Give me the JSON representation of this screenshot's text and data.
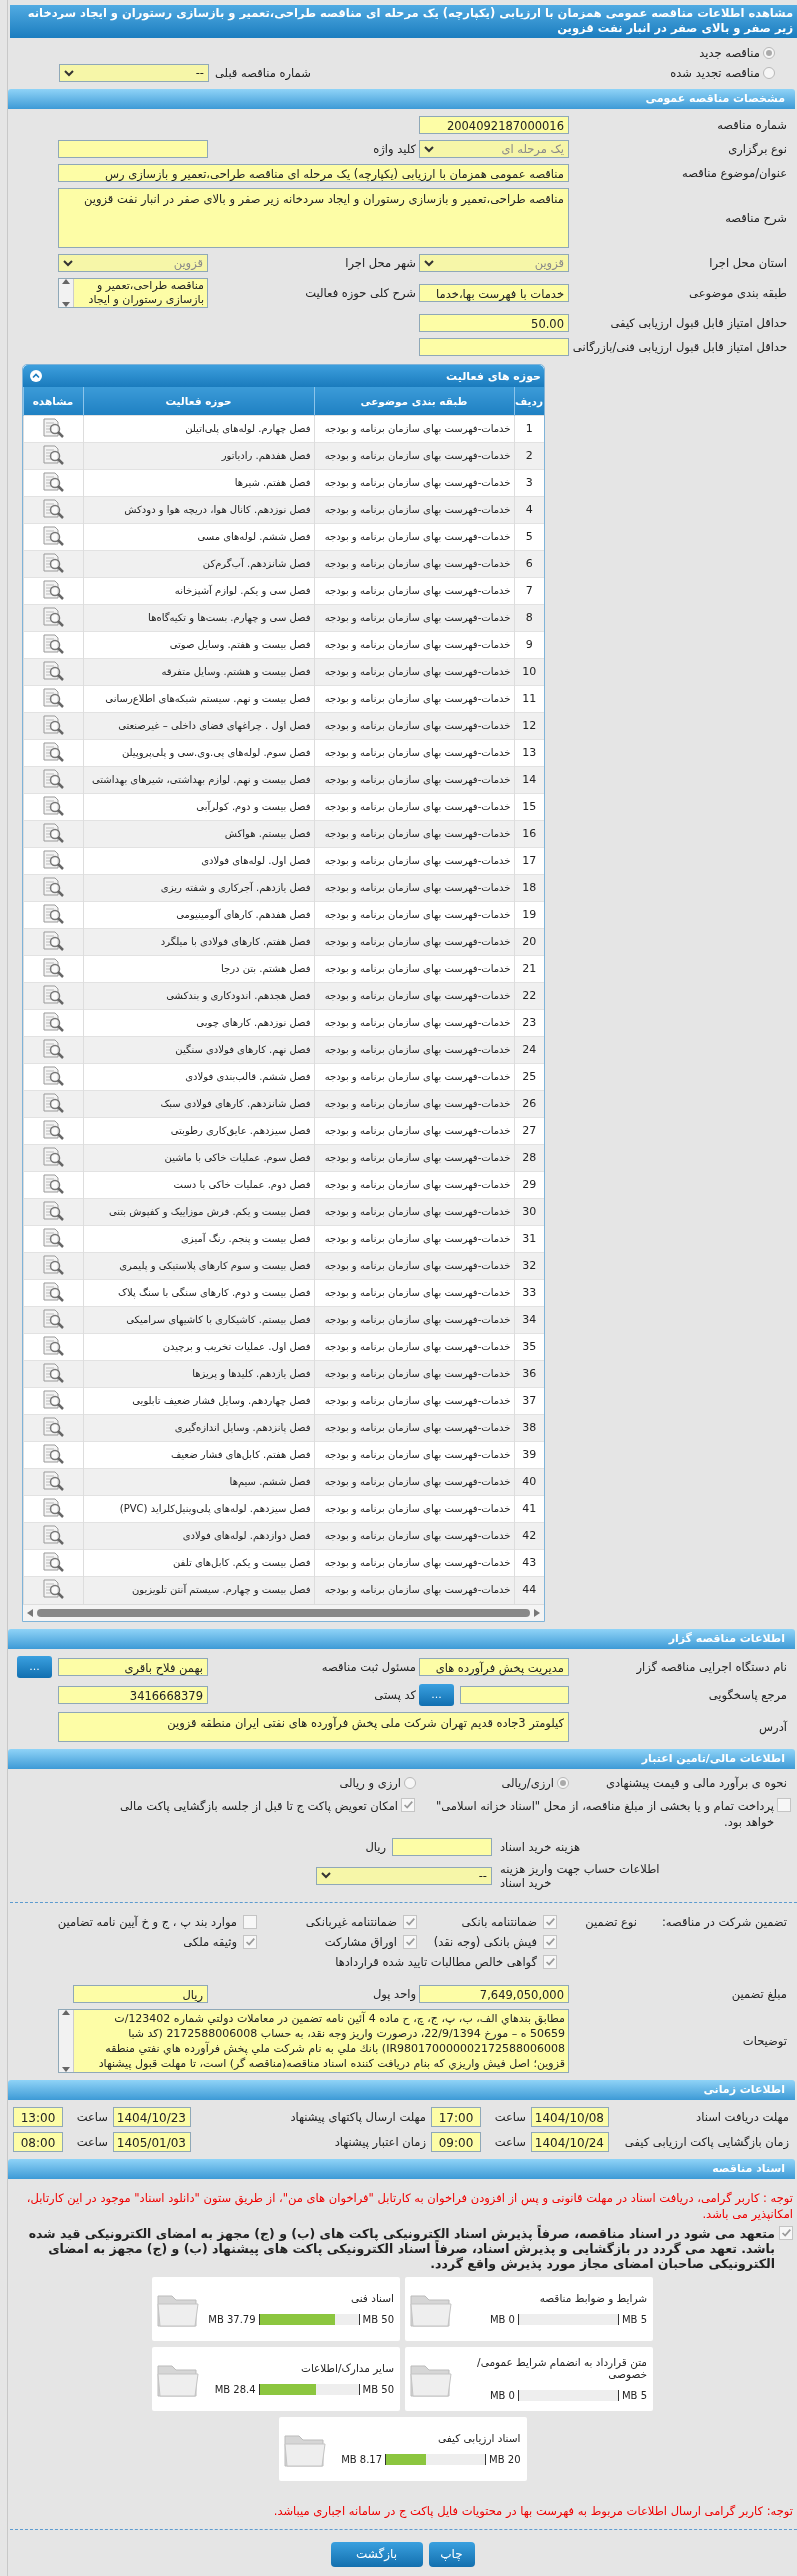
{
  "title": "مشاهده اطلاعات مناقصه عمومی همزمان با ارزیابی (یکپارچه) یک مرحله ای مناقصه طراحی،تعمیر و بازسازی رستوران و ایجاد سردخانه زیر صفر و بالای صفر در انبار نفت قزوین",
  "tender_type": {
    "options": [
      {
        "label": "مناقصه جدید",
        "selected": true
      },
      {
        "label": "مناقصه تجدید شده",
        "selected": false
      }
    ],
    "previous": {
      "label": "شماره مناقصه قبلی",
      "kind": "select",
      "value": "--",
      "disabled": false
    }
  },
  "general": {
    "header": "مشخصات مناقصه عمومی",
    "rows": [
      [
        {
          "label": "شماره مناقصه",
          "kind": "input",
          "value": "2004092187000016"
        }
      ],
      [
        {
          "label": "نوع برگزاری",
          "kind": "select",
          "value": "یک مرحله ای",
          "disabled": true
        },
        {
          "label": "کلید واژه",
          "kind": "input"
        }
      ],
      [
        {
          "label": "عنوان/موضوع مناقصه",
          "kind": "wide",
          "value": "مناقصه عمومی همزمان با ارزیابی (یکپارچه) یک مرحله ای مناقصه طراحی،تعمیر و بازسازی رس"
        }
      ],
      [
        {
          "label": "شرح مناقصه",
          "kind": "textarea",
          "value": "مناقصه طراحی،تعمیر و بازسازی رستوران و ایجاد سردخانه زیر صفر و بالای صفر در انبار نفت قزوین"
        }
      ],
      [
        {
          "label": "استان محل اجرا",
          "kind": "select",
          "value": "قزوین",
          "disabled": true
        },
        {
          "label": "شهر محل اجرا",
          "kind": "select",
          "value": "قزوین",
          "disabled": true
        }
      ],
      [
        {
          "label": "طبقه بندی موضوعی",
          "kind": "input",
          "value": "خدمات با فهرست بها،خدما"
        },
        {
          "label": "شرح کلی حوزه فعالیت",
          "kind": "scrollbox",
          "value": "مناقصه طراحی،تعمیر و بازسازی رستوران و ایجاد"
        }
      ],
      [
        {
          "label": "حداقل امتیاز قابل قبول ارزیابی کیفی",
          "kind": "input",
          "value": "50.00"
        }
      ],
      [
        {
          "label": "حداقل امتیاز قابل قبول ارزیابی فنی/بازرگانی",
          "kind": "input"
        }
      ]
    ]
  },
  "activities": {
    "title": "حوزه های فعالیت",
    "columns": [
      "ردیف",
      "طبقه بندی موضوعی",
      "حوزه فعالیت",
      "مشاهده"
    ],
    "rows": [
      {
        "no": "1",
        "category": "خدمات-فهرست بهای سازمان برنامه و بودجه",
        "activity": "فصل چهارم. لوله‌های پلی‌اتیلن"
      },
      {
        "no": "2",
        "category": "خدمات-فهرست بهای سازمان برنامه و بودجه",
        "activity": "فصل هفدهم. رادیاتور"
      },
      {
        "no": "3",
        "category": "خدمات-فهرست بهای سازمان برنامه و بودجه",
        "activity": "فصل هفتم. شیرها"
      },
      {
        "no": "4",
        "category": "خدمات-فهرست بهای سازمان برنامه و بودجه",
        "activity": "فصل نوزدهم. کانال هوا، دریچه هوا و دودکش"
      },
      {
        "no": "5",
        "category": "خدمات-فهرست بهای سازمان برنامه و بودجه",
        "activity": "فصل ششم. لوله‌های مسی"
      },
      {
        "no": "6",
        "category": "خدمات-فهرست بهای سازمان برنامه و بودجه",
        "activity": "فصل شانزدهم. آب‌گرم‌کن"
      },
      {
        "no": "7",
        "category": "خدمات-فهرست بهای سازمان برنامه و بودجه",
        "activity": "فصل سی و یکم. لوازم آشپزخانه"
      },
      {
        "no": "8",
        "category": "خدمات-فهرست بهای سازمان برنامه و بودجه",
        "activity": "فصل سی و چهارم. بست‌ها و تکیه‌گاه‌ها"
      },
      {
        "no": "9",
        "category": "خدمات-فهرست بهای سازمان برنامه و بودجه",
        "activity": "فصل بیست و هفتم. وسایل صوتی"
      },
      {
        "no": "10",
        "category": "خدمات-فهرست بهای سازمان برنامه و بودجه",
        "activity": "فصل بیست و هشتم. وسایل متفرقه"
      },
      {
        "no": "11",
        "category": "خدمات-فهرست بهای سازمان برنامه و بودجه",
        "activity": "فصل بیست و نهم. سیستم شبکه‌های اطلاع‌رسانی"
      },
      {
        "no": "12",
        "category": "خدمات-فهرست بهای سازمان برنامه و بودجه",
        "activity": "فصل اول . چراغهای فضای داخلی – غیرصنعتی"
      },
      {
        "no": "13",
        "category": "خدمات-فهرست بهای سازمان برنامه و بودجه",
        "activity": "فصل سوم. لوله‌های پی.وی.سی و پلی‌پروپیلن"
      },
      {
        "no": "14",
        "category": "خدمات-فهرست بهای سازمان برنامه و بودجه",
        "activity": "فصل بیست و نهم. لوازم بهداشتی، شیرهای بهداشتی"
      },
      {
        "no": "15",
        "category": "خدمات-فهرست بهای سازمان برنامه و بودجه",
        "activity": "فصل بیست و دوم. کولرآبی"
      },
      {
        "no": "16",
        "category": "خدمات-فهرست بهای سازمان برنامه و بودجه",
        "activity": "فصل بیستم. هواکش"
      },
      {
        "no": "17",
        "category": "خدمات-فهرست بهای سازمان برنامه و بودجه",
        "activity": "فصل اول. لوله‌های فولادی"
      },
      {
        "no": "18",
        "category": "خدمات-فهرست بهای سازمان برنامه و بودجه",
        "activity": "فصل یازدهم. آجرکاری و شفته ریزی"
      },
      {
        "no": "19",
        "category": "خدمات-فهرست بهای سازمان برنامه و بودجه",
        "activity": "فصل هفدهم. کارهای آلومینیومی"
      },
      {
        "no": "20",
        "category": "خدمات-فهرست بهای سازمان برنامه و بودجه",
        "activity": "فصل هفتم. کارهای فولادی با میلگرد"
      },
      {
        "no": "21",
        "category": "خدمات-فهرست بهای سازمان برنامه و بودجه",
        "activity": "فصل هشتم. بتن درجا"
      },
      {
        "no": "22",
        "category": "خدمات-فهرست بهای سازمان برنامه و بودجه",
        "activity": "فصل هجدهم. اندودکاری و بندکشی"
      },
      {
        "no": "23",
        "category": "خدمات-فهرست بهای سازمان برنامه و بودجه",
        "activity": "فصل نوزدهم. کارهای چوبی"
      },
      {
        "no": "24",
        "category": "خدمات-فهرست بهای سازمان برنامه و بودجه",
        "activity": "فصل نهم. کارهای فولادی سنگین"
      },
      {
        "no": "25",
        "category": "خدمات-فهرست بهای سازمان برنامه و بودجه",
        "activity": "فصل ششم. قالب‌بندی فولادی"
      },
      {
        "no": "26",
        "category": "خدمات-فهرست بهای سازمان برنامه و بودجه",
        "activity": "فصل شانزدهم. کارهای فولادی سبک"
      },
      {
        "no": "27",
        "category": "خدمات-فهرست بهای سازمان برنامه و بودجه",
        "activity": "فصل سیزدهم. عایق‌کاری رطوبتی"
      },
      {
        "no": "28",
        "category": "خدمات-فهرست بهای سازمان برنامه و بودجه",
        "activity": "فصل سوم. عملیات خاکی با ماشین"
      },
      {
        "no": "29",
        "category": "خدمات-فهرست بهای سازمان برنامه و بودجه",
        "activity": "فصل دوم. عملیات خاکی با دست"
      },
      {
        "no": "30",
        "category": "خدمات-فهرست بهای سازمان برنامه و بودجه",
        "activity": "فصل بیست و یکم. فرش موزاییک و کفپوش بتنی"
      },
      {
        "no": "31",
        "category": "خدمات-فهرست بهای سازمان برنامه و بودجه",
        "activity": "فصل بیست و پنجم. رنگ آمیزی"
      },
      {
        "no": "32",
        "category": "خدمات-فهرست بهای سازمان برنامه و بودجه",
        "activity": "فصل بیست و سوم کارهای پلاستیکی و پلیمری"
      },
      {
        "no": "33",
        "category": "خدمات-فهرست بهای سازمان برنامه و بودجه",
        "activity": "فصل بیست و دوم. کارهای سنگی با سنگ پلاک"
      },
      {
        "no": "34",
        "category": "خدمات-فهرست بهای سازمان برنامه و بودجه",
        "activity": "فصل بیستم. کاشیکاری با کاشیهای سرامیکی"
      },
      {
        "no": "35",
        "category": "خدمات-فهرست بهای سازمان برنامه و بودجه",
        "activity": "فصل اول. عملیات تخریب و برچیدن"
      },
      {
        "no": "36",
        "category": "خدمات-فهرست بهای سازمان برنامه و بودجه",
        "activity": "فصل یازدهم. کلیدها و پریزها"
      },
      {
        "no": "37",
        "category": "خدمات-فهرست بهای سازمان برنامه و بودجه",
        "activity": "فصل چهاردهم. وسایل فشار ضعیف تابلویی"
      },
      {
        "no": "38",
        "category": "خدمات-فهرست بهای سازمان برنامه و بودجه",
        "activity": "فصل پانزدهم. وسایل اندازه‌گیری"
      },
      {
        "no": "39",
        "category": "خدمات-فهرست بهای سازمان برنامه و بودجه",
        "activity": "فصل هفتم. کابل‌های فشار ضعیف"
      },
      {
        "no": "40",
        "category": "خدمات-فهرست بهای سازمان برنامه و بودجه",
        "activity": "فصل ششم. سیم‌ها"
      },
      {
        "no": "41",
        "category": "خدمات-فهرست بهای سازمان برنامه و بودجه",
        "activity": "فصل سیزدهم. لوله‌های پلی‌وینیل‌کلراید (PVC)"
      },
      {
        "no": "42",
        "category": "خدمات-فهرست بهای سازمان برنامه و بودجه",
        "activity": "فصل دوازدهم. لوله‌های فولادی"
      },
      {
        "no": "43",
        "category": "خدمات-فهرست بهای سازمان برنامه و بودجه",
        "activity": "فصل بیست و یکم. کابل‌های تلفن"
      },
      {
        "no": "44",
        "category": "خدمات-فهرست بهای سازمان برنامه و بودجه",
        "activity": "فصل بیست و چهارم. سیستم آنتن تلویزیون"
      }
    ]
  },
  "organizer": {
    "header": "اطلاعات مناقصه گزار",
    "rows": [
      [
        {
          "label": "نام دستگاه اجرایی مناقصه گزار",
          "kind": "input",
          "value": "مدیریت پخش فرآورده های"
        },
        {
          "label": "مسئول ثبت مناقصه",
          "kind": "input",
          "value": "بهمن فلاح باقری",
          "button": "..."
        }
      ],
      [
        {
          "label": "مرجع پاسخگویی",
          "kind": "input",
          "button": "..."
        },
        {
          "label": "کد پستی",
          "kind": "input",
          "value": "3416668379"
        }
      ],
      [
        {
          "label": "آدرس",
          "kind": "address",
          "value": "کیلومتر 3جاده قدیم تهران شرکت ملی پخش فرآورده های نفتی ایران منطقه قزوین"
        }
      ]
    ]
  },
  "finance": {
    "header": "اطلاعات مالی/تامین اعتبار",
    "estimate": {
      "label": "نحوه ی برآورد مالی و قیمت پیشنهادی",
      "options": [
        {
          "label": "ارزی/ریالی",
          "selected": true
        },
        {
          "label": "ارزی و ریالی",
          "selected": false
        }
      ]
    },
    "options": [
      {
        "label": "پرداخت تمام و یا بخشی از مبلغ مناقصه، از محل \"اسناد خزانه اسلامی\" خواهد بود.",
        "checked": false
      },
      {
        "label": "امکان تعویض پاکت ج تا قبل از جلسه بازگشایی پاکت مالی",
        "checked": true
      }
    ],
    "doc_cost": {
      "label": "هزینه خرید اسناد",
      "unit": "ریال"
    },
    "account": {
      "label": "اطلاعات حساب جهت واریز هزینه خرید اسناد",
      "kind": "select",
      "value": "--",
      "disabled": false
    },
    "guarantee": {
      "label": "تضمین شرکت در مناقصه:",
      "type_label": "نوع تضمین",
      "types": [
        {
          "label": "ضمانتنامه بانکی",
          "checked": true
        },
        {
          "label": "ضمانتنامه غیربانکی",
          "checked": true
        },
        {
          "label": "موارد بند پ ، ج و خ آیین نامه تضامین",
          "checked": false
        },
        {
          "label": "فیش بانکی (وجه نقد)",
          "checked": true
        },
        {
          "label": "اوراق مشارکت",
          "checked": true
        },
        {
          "label": "وثیقه ملکی",
          "checked": true
        },
        {
          "label": "گواهی خالص مطالبات تایید شده قراردادها",
          "checked": true
        }
      ]
    },
    "amount": [
      {
        "label": "مبلغ تضمین",
        "kind": "input",
        "value": "7,649,050,000"
      },
      {
        "label": "واحد پول",
        "kind": "input",
        "value": "ریال"
      }
    ],
    "notes": {
      "label": "توضیحات",
      "value": "مطابق بندهاي الف، ب، پ، ج، چ، ح ماده 4 آئين نامه تضمين در معاملات دولتي شماره 123402/ت 50659 ه – مورخ 22/9/1394، درصورت واريز وجه نقد، به حساب 2172588006008 (کد شبا IR980170000002172588006008) بانك ملي به نام شركت ملي پخش فرآورده هاي نفتي منطقه قزوين؛ اصل فيش واريزي كه بنام دريافت كننده اسناد مناقصه(مناقصه گر) است، تا مهلت قبول پيشنهاد"
    }
  },
  "timing": {
    "header": "اطلاعات زمانی",
    "items": [
      {
        "label": "مهلت دریافت اسناد",
        "date": "1404/10/08",
        "time_label": "ساعت",
        "time": "17:00"
      },
      {
        "label": "مهلت ارسال پاکتهای پیشنهاد",
        "date": "1404/10/23",
        "time_label": "ساعت",
        "time": "13:00"
      },
      {
        "label": "زمان بازگشایی پاکت ارزیابی کیفی",
        "date": "1404/10/24",
        "time_label": "ساعت",
        "time": "09:00"
      },
      {
        "label": "زمان اعتبار پیشنهاد",
        "date": "1405/01/03",
        "time_label": "ساعت",
        "time": "08:00"
      }
    ]
  },
  "documents": {
    "header": "اسناد مناقصه",
    "notice": "توجه : کاربر گرامی، دریافت اسناد در مهلت قانونی و پس از افزودن فراخوان به کارتابل \"فراخوان های من\"، از طریق ستون \"دانلود اسناد\" موجود در این کارتابل، امکانپذیر می باشد.",
    "commitment": {
      "label": "متعهد می شود در اسناد مناقصه، صرفاً پذیرش اسناد الکترونیکی پاکت های (ب) و (ج) مجهز به امضای الکترونیکی قید شده باشد. تعهد می گردد در بازگشایی و پذیرش اسناد، صرفاً اسناد الکترونیکی پاکت های پیشنهاد (ب) و (ج) مجهز به امضای الکترونیکی صاحبان امضای مجاز مورد پذیرش واقع گردد.",
      "checked": true
    },
    "files": [
      {
        "name": "شرایط و ضوابط مناقصه",
        "max": "5 MB",
        "used": "0 MB",
        "level": 0
      },
      {
        "name": "اسناد فنی",
        "max": "50 MB",
        "used": "37.79 MB",
        "level": 0.756
      },
      {
        "name": "متن قرارداد به انضمام شرایط عمومی/خصوصی",
        "max": "5 MB",
        "used": "0 MB",
        "level": 0
      },
      {
        "name": "سایر مدارک/اطلاعات",
        "max": "50 MB",
        "used": "28.4 MB",
        "level": 0.568
      },
      {
        "name": "اسناد ارزیابی کیفی",
        "max": "20 MB",
        "used": "8.17 MB",
        "level": 0.4085
      }
    ],
    "footer_notice": "توجه: کاربر گرامی ارسال اطلاعات مربوط به فهرست بها در محتویات فایل پاکت ج در سامانه اجباری میباشد."
  },
  "buttons": [
    "چاپ",
    "بازگشت"
  ]
}
